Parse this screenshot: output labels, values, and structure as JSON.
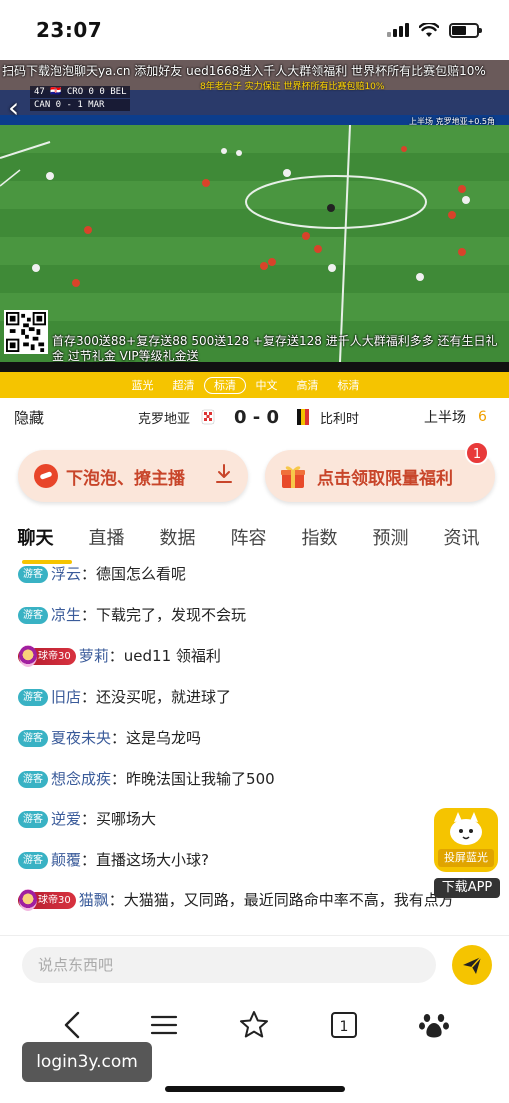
{
  "status_bar": {
    "time": "23:07"
  },
  "video": {
    "marquee": "扫码下载泡泡聊天ya.cn 添加好友 ued1668进入千人大群领福利 世界杯所有比赛包赔10%",
    "scorebug": [
      "47 🇭🇷 CRO 0 0 BEL",
      "CAN 0 - 1 MAR"
    ],
    "overlay_mid": [
      "8年老台子 实力保证 世界杯所有比赛包赔10%"
    ],
    "overlay_right": [
      "上半场 克罗地亚+0.5角"
    ],
    "ad_text": "首存300送88+复存送88 500送128 +复存送128 进千人大群福利多多 还有生日礼金 过节礼金 VIP等级礼金送",
    "back_icon": "back-arrow-icon"
  },
  "quality": {
    "items": [
      "蓝光",
      "超清",
      "标清",
      "中文",
      "高清",
      "标清"
    ],
    "selected_index": 2
  },
  "match": {
    "hide_label": "隐藏",
    "home_team": "克罗地亚",
    "score": "0 - 0",
    "away_team": "比利时",
    "period": "上半场",
    "minute": "6"
  },
  "promo": {
    "left_label": "下泡泡、撩主播",
    "right_label": "点击领取限量福利",
    "badge_count": "1"
  },
  "tabs": [
    "聊天",
    "直播",
    "数据",
    "阵容",
    "指数",
    "预测",
    "资讯"
  ],
  "active_tab": 0,
  "chat": [
    {
      "role": "游客",
      "user": "浮云",
      "text": "德国怎么看呢"
    },
    {
      "role": "游客",
      "user": "凉生",
      "text": "下载完了，发现不会玩"
    },
    {
      "role": "球帝30",
      "user": "萝莉",
      "text": "ued11 领福利"
    },
    {
      "role": "游客",
      "user": "旧店",
      "text": "还没买呢，就进球了"
    },
    {
      "role": "游客",
      "user": "夏夜未央",
      "text": "这是乌龙吗"
    },
    {
      "role": "游客",
      "user": "想念成疾",
      "text": "昨晚法国让我输了500"
    },
    {
      "role": "游客",
      "user": "逆爱",
      "text": "买哪场大"
    },
    {
      "role": "游客",
      "user": "颠覆",
      "text": "直播这场大小球?"
    },
    {
      "role": "球帝30",
      "user": "猫飘",
      "text": "大猫猫，又同路，最近同路命中率不高，我有点方"
    }
  ],
  "app_fab": {
    "label": "投屏蓝光",
    "download": "下载APP"
  },
  "input": {
    "placeholder": "说点东西吧",
    "value": ""
  },
  "watermark": "login3y.com",
  "colors": {
    "accent": "#f5c400",
    "promo_text": "#c8452a",
    "guest_badge": "#39b2c4",
    "badge": "#e83a3a"
  }
}
